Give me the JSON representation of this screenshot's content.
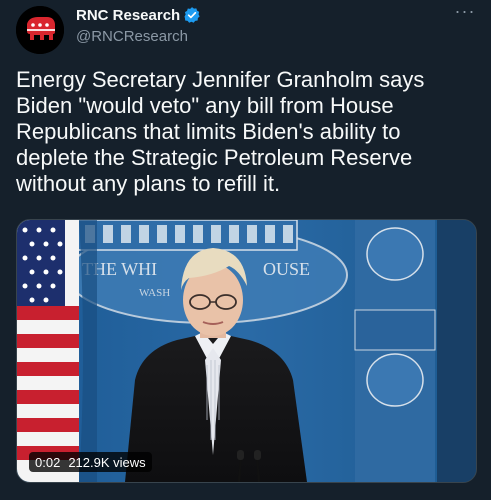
{
  "author": {
    "display_name": "RNC Research",
    "handle": "@RNCResearch",
    "avatar_icon": "republican-elephant-icon",
    "verified_icon": "verified-badge-icon",
    "verified_color": "#1d9bf0"
  },
  "menu": {
    "more_icon": "more-horizontal-icon",
    "more_label": "···"
  },
  "tweet": {
    "text": "Energy Secretary Jennifer Granholm says Biden \"would veto\" any bill from House Republicans that limits Biden's ability to deplete the Strategic Petroleum Reserve without any plans to refill it."
  },
  "media": {
    "kind": "video",
    "backdrop_text_1": "THE WHI",
    "backdrop_text_2": "OUSE",
    "backdrop_text_3": "WASH",
    "duration": "0:02",
    "views": "212.9K views"
  },
  "colors": {
    "background": "#15202b",
    "text_primary": "#f7f9f9",
    "text_secondary": "#8b98a5",
    "border": "#38444d"
  }
}
